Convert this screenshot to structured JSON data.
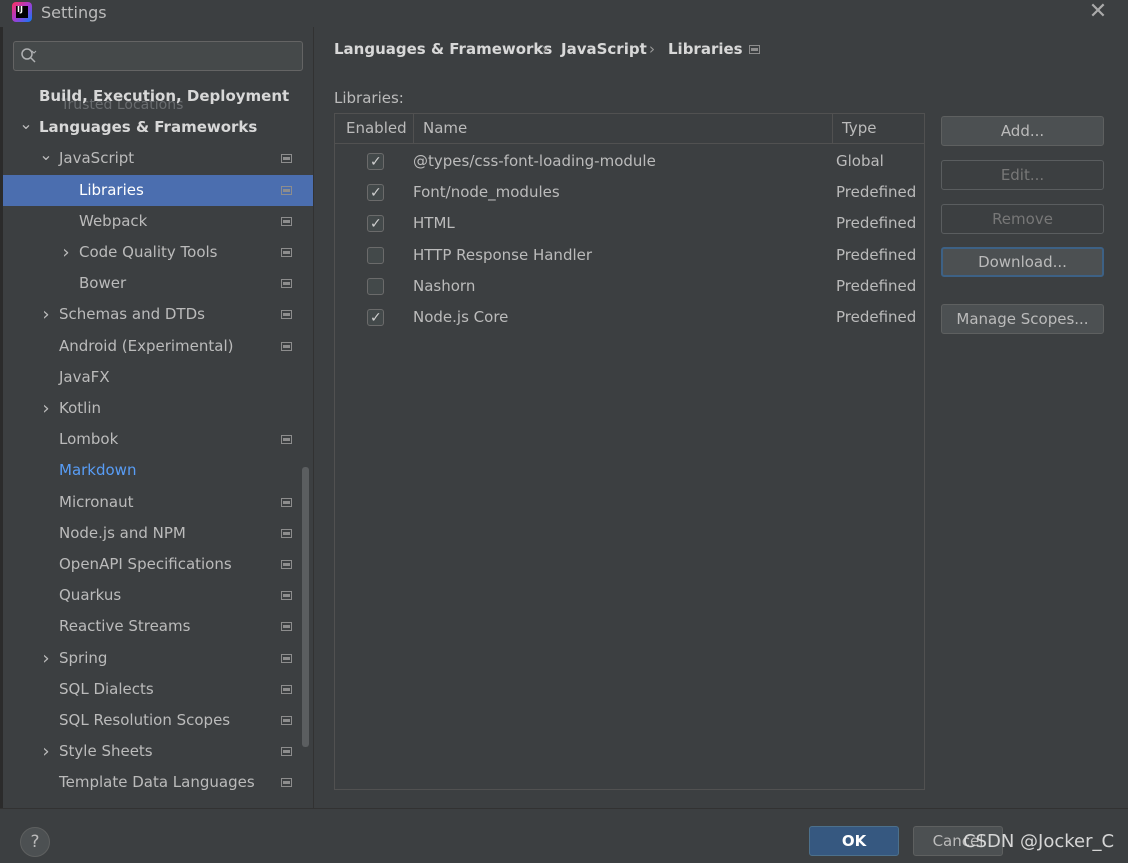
{
  "window": {
    "title": "Settings",
    "app_icon_text": "IJ"
  },
  "search": {
    "value": "",
    "placeholder": ""
  },
  "sidebar": {
    "ghost_text": "Trusted Locations",
    "items": [
      {
        "label": "Build, Execution, Deployment",
        "level": 0,
        "bold": true,
        "chevron": "",
        "icon": false
      },
      {
        "label": "Languages & Frameworks",
        "level": 0,
        "bold": true,
        "chevron": "down",
        "icon": false
      },
      {
        "label": "JavaScript",
        "level": 1,
        "chevron": "down",
        "icon": true
      },
      {
        "label": "Libraries",
        "level": 2,
        "chevron": "",
        "icon": true,
        "selected": true
      },
      {
        "label": "Webpack",
        "level": 2,
        "chevron": "",
        "icon": true
      },
      {
        "label": "Code Quality Tools",
        "level": 2,
        "chevron": "right",
        "icon": true
      },
      {
        "label": "Bower",
        "level": 2,
        "chevron": "",
        "icon": true
      },
      {
        "label": "Schemas and DTDs",
        "level": 1,
        "chevron": "right",
        "icon": true
      },
      {
        "label": "Android (Experimental)",
        "level": 1,
        "chevron": "",
        "icon": true
      },
      {
        "label": "JavaFX",
        "level": 1,
        "chevron": "",
        "icon": false
      },
      {
        "label": "Kotlin",
        "level": 1,
        "chevron": "right",
        "icon": false
      },
      {
        "label": "Lombok",
        "level": 1,
        "chevron": "",
        "icon": true
      },
      {
        "label": "Markdown",
        "level": 1,
        "chevron": "",
        "icon": false,
        "link": true
      },
      {
        "label": "Micronaut",
        "level": 1,
        "chevron": "",
        "icon": true
      },
      {
        "label": "Node.js and NPM",
        "level": 1,
        "chevron": "",
        "icon": true
      },
      {
        "label": "OpenAPI Specifications",
        "level": 1,
        "chevron": "",
        "icon": true
      },
      {
        "label": "Quarkus",
        "level": 1,
        "chevron": "",
        "icon": true
      },
      {
        "label": "Reactive Streams",
        "level": 1,
        "chevron": "",
        "icon": true
      },
      {
        "label": "Spring",
        "level": 1,
        "chevron": "right",
        "icon": true
      },
      {
        "label": "SQL Dialects",
        "level": 1,
        "chevron": "",
        "icon": true
      },
      {
        "label": "SQL Resolution Scopes",
        "level": 1,
        "chevron": "",
        "icon": true
      },
      {
        "label": "Style Sheets",
        "level": 1,
        "chevron": "right",
        "icon": true
      },
      {
        "label": "Template Data Languages",
        "level": 1,
        "chevron": "",
        "icon": true
      }
    ]
  },
  "breadcrumb": {
    "items": [
      "Languages & Frameworks",
      "JavaScript",
      "Libraries"
    ],
    "separator": "›"
  },
  "libraries": {
    "label": "Libraries:",
    "columns": [
      "Enabled",
      "Name",
      "Type"
    ],
    "rows": [
      {
        "enabled": true,
        "name": "@types/css-font-loading-module",
        "type": "Global"
      },
      {
        "enabled": true,
        "name": "Font/node_modules",
        "type": "Predefined"
      },
      {
        "enabled": true,
        "name": "HTML",
        "type": "Predefined"
      },
      {
        "enabled": false,
        "name": "HTTP Response Handler",
        "type": "Predefined"
      },
      {
        "enabled": false,
        "name": "Nashorn",
        "type": "Predefined"
      },
      {
        "enabled": true,
        "name": "Node.js Core",
        "type": "Predefined"
      }
    ]
  },
  "actions": {
    "add": "Add...",
    "edit": "Edit...",
    "remove": "Remove",
    "download": "Download...",
    "manage_scopes": "Manage Scopes..."
  },
  "footer": {
    "help": "?",
    "ok": "OK",
    "cancel": "Cancel",
    "watermark": "CSDN @Jocker_C"
  },
  "colors": {
    "background": "#3c3f41",
    "selection": "#4b6eaf",
    "link": "#589df6",
    "ok_button": "#365880"
  }
}
